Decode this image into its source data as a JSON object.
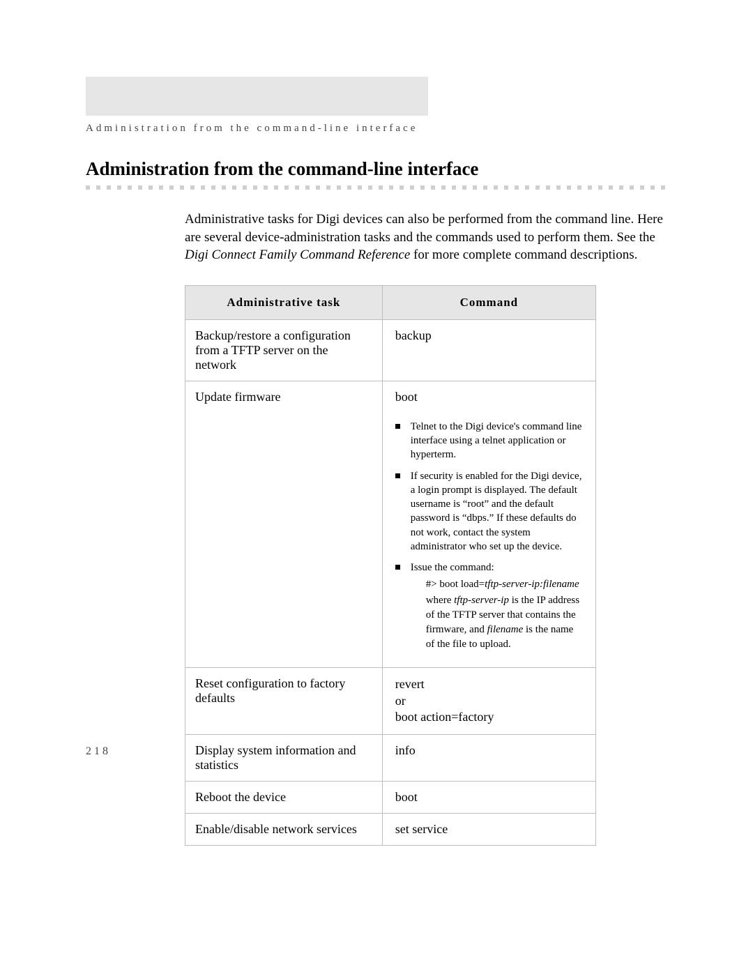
{
  "chapter_header": "Administration from the command-line interface",
  "section_title": "Administration from the command-line interface",
  "intro": {
    "line1": "Administrative tasks for Digi devices can also be performed from the command line. Here are several device-administration tasks and the commands used to perform them. See the ",
    "ref": "Digi Connect Family Command Reference",
    "line2": " for more complete command descriptions."
  },
  "table": {
    "headers": {
      "task": "Administrative task",
      "cmd": "Command"
    },
    "rows": [
      {
        "task": "Backup/restore a configuration from a TFTP server on the network",
        "cmd": "backup"
      },
      {
        "task": "Update firmware",
        "cmd": "boot"
      },
      {
        "task": "Reset configuration to factory defaults",
        "cmd_lines": [
          "revert",
          "or",
          "boot action=factory"
        ]
      },
      {
        "task": "Display system information and statistics",
        "cmd": "info"
      },
      {
        "task": "Reboot the device",
        "cmd": "boot"
      },
      {
        "task": "Enable/disable network services",
        "cmd": "set service"
      }
    ],
    "boot_bullets": {
      "b1": "Telnet to the Digi device's command line interface using a telnet application or hyperterm.",
      "b2": "If security is enabled for the Digi device, a login prompt is displayed. The default username is “root” and the default password is “dbps.” If these defaults do not work, contact the system administrator who set up the device.",
      "b3": "Issue the command:",
      "b3_cmd_prefix": "#> boot load=",
      "b3_cmd_args": "tftp-server-ip:filename",
      "b3_note_pre": "where ",
      "b3_note_arg1": "tftp-server-ip",
      "b3_note_mid": " is the IP address of the TFTP server that contains the firmware, and ",
      "b3_note_arg2": "filename",
      "b3_note_post": " is the name of the file to upload."
    }
  },
  "page_number": "218"
}
